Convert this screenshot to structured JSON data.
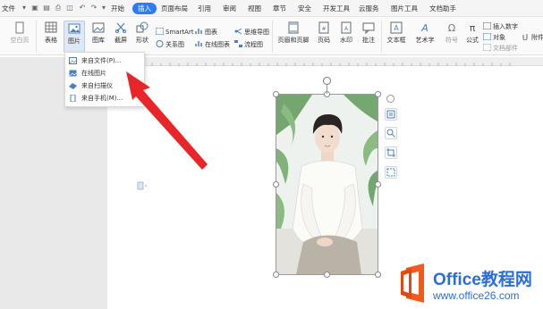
{
  "menubar": {
    "file_label": "文件",
    "tabs": [
      "开始",
      "插入",
      "页面布局",
      "引用",
      "审阅",
      "视图",
      "章节",
      "安全",
      "开发工具",
      "云服务",
      "图片工具",
      "文档助手"
    ],
    "active_tab": "插入"
  },
  "ribbon": {
    "blank_page": "空白页",
    "table": "表格",
    "picture": "图片",
    "gallery": "图库",
    "screenshot": "截屏",
    "shape": "形状",
    "smartart": "SmartArt",
    "chart": "图表",
    "mindmap": "思维导图",
    "relation": "关系图",
    "online_chart": "在线图表",
    "flowchart": "流程图",
    "header_footer": "页眉和页脚",
    "page_number": "页码",
    "watermark": "水印",
    "comment": "批注",
    "textbox": "文本框",
    "wordart": "艺术字",
    "symbol": "符号",
    "formula": "公式",
    "insert_number": "插入数字",
    "object": "对象",
    "attachment": "附件",
    "text_section": "文档部件"
  },
  "picture_menu": {
    "items": [
      {
        "label": "来自文件(P)...",
        "icon": "file-image-icon"
      },
      {
        "label": "在线图片",
        "icon": "online-image-icon"
      },
      {
        "label": "来自扫描仪",
        "icon": "scanner-icon"
      },
      {
        "label": "来自手机(M)...",
        "icon": "phone-icon"
      }
    ]
  },
  "watermark_brand": {
    "name": "Office教程网",
    "url": "www.office26.com"
  },
  "colors": {
    "accent": "#2d7cf5",
    "arrow": "#e8262a",
    "brand_orange": "#f05a1a",
    "brand_blue": "#2b6fd6"
  }
}
